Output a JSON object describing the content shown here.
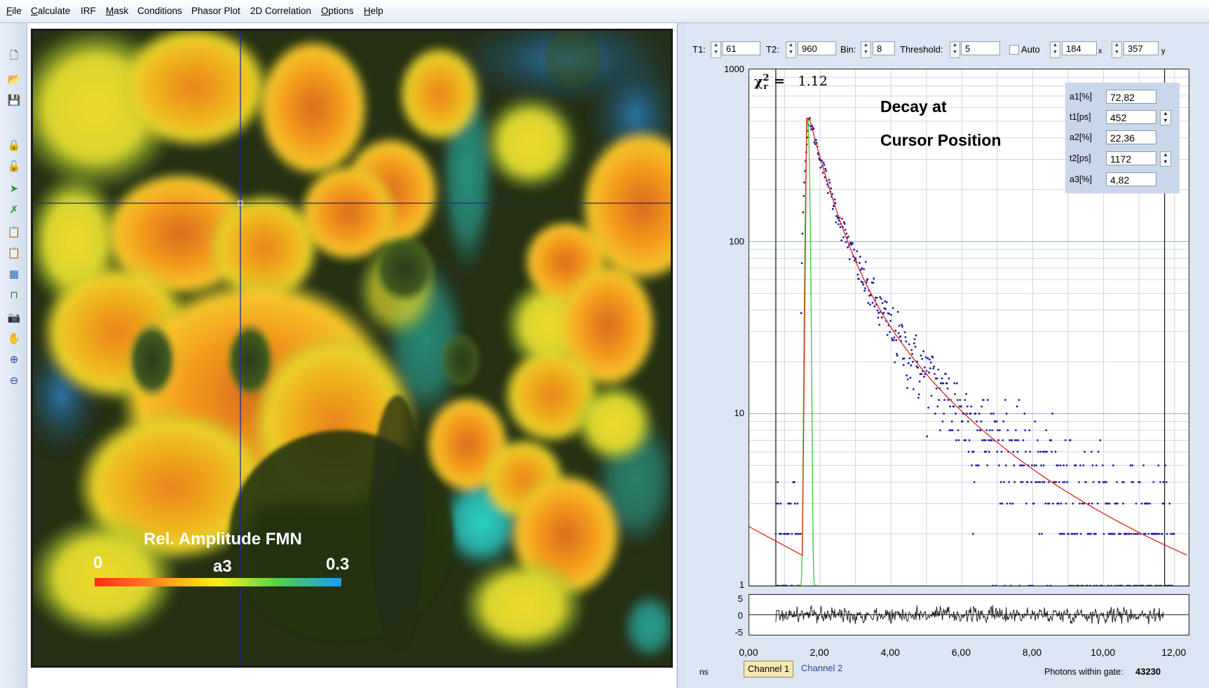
{
  "menu": [
    {
      "underline": "F",
      "rest": "ile"
    },
    {
      "underline": "C",
      "rest": "alculate"
    },
    {
      "underline": "",
      "rest": "IRF"
    },
    {
      "underline": "M",
      "rest": "ask"
    },
    {
      "underline": "",
      "rest": "Conditions"
    },
    {
      "underline": "",
      "rest": "Phasor Plot"
    },
    {
      "underline": "",
      "rest": "2D Correlation"
    },
    {
      "underline": "O",
      "rest": "ptions"
    },
    {
      "underline": "H",
      "rest": "elp"
    }
  ],
  "toolbar_icons": [
    "new-file-icon",
    "open-folder-icon",
    "save-icon",
    "lock-icon",
    "unlock-icon",
    "green-arrow-icon",
    "green-arrow-cross-icon",
    "copy-clipboard-icon",
    "paste-clipboard-icon",
    "image-select-icon",
    "trace-icon",
    "camera-icon",
    "hand-icon",
    "zoom-in-icon",
    "zoom-out-icon"
  ],
  "image": {
    "colorbar_title": "Rel. Amplitude FMN",
    "colorbar_min": "0",
    "colorbar_param": "a3",
    "colorbar_max": "0.3",
    "colors": [
      "#ff2a1a",
      "#ff8a1a",
      "#fff21a",
      "#4cd24a",
      "#1a9aff"
    ]
  },
  "controls": {
    "t1_label": "T1:",
    "t1_value": "61",
    "t2_label": "T2:",
    "t2_value": "960",
    "bin_label": "Bin:",
    "bin_value": "8",
    "threshold_label": "Threshold:",
    "threshold_value": "5",
    "auto_label": "Auto",
    "x_value": "184",
    "x_unit": "x",
    "y_value": "357",
    "y_unit": "y"
  },
  "plot": {
    "chi_symbol": "χ",
    "chi_sup": "2",
    "chi_sub": "r",
    "chi_eq": "=",
    "chi_value": "1.12",
    "title_line1": "Decay at",
    "title_line2": "Cursor Position",
    "y_ticks": [
      "1000",
      "100",
      "10",
      "1"
    ],
    "x_ticks": [
      "0,00",
      "2,00",
      "4,00",
      "6,00",
      "8,00",
      "10,00",
      "12,00"
    ],
    "resid_ticks": [
      "5",
      "0",
      "-5"
    ],
    "x_unit": "ns",
    "photons_label": "Photons within gate:",
    "photons_value": "43230",
    "colors": {
      "data": "#1a1aa8",
      "fit": "#e0241a",
      "irf": "#33cc33",
      "irf_fit": "#c0201a"
    }
  },
  "params": [
    {
      "label": "a1[%]",
      "value": "72,82",
      "spinner": false
    },
    {
      "label": "t1[ps]",
      "value": "452",
      "spinner": true
    },
    {
      "label": "a2[%]",
      "value": "22,36",
      "spinner": false
    },
    {
      "label": "t2[ps]",
      "value": "1172",
      "spinner": true
    },
    {
      "label": "a3[%]",
      "value": "4,82",
      "spinner": false
    }
  ],
  "tabs": {
    "channel1": "Channel 1",
    "channel2": "Channel 2"
  },
  "chart_data": {
    "type": "scatter",
    "y_scale": "log",
    "ylim": [
      1,
      1000
    ],
    "xlim": [
      0,
      12.4
    ],
    "fit_model": "triexponential",
    "amplitudes_percent": [
      72.82,
      22.36,
      4.82
    ],
    "lifetimes_ps": [
      452,
      1172
    ],
    "peak_counts": 520,
    "peak_time_ns": 1.7,
    "background_counts": 2,
    "chi2_r": 1.12
  }
}
